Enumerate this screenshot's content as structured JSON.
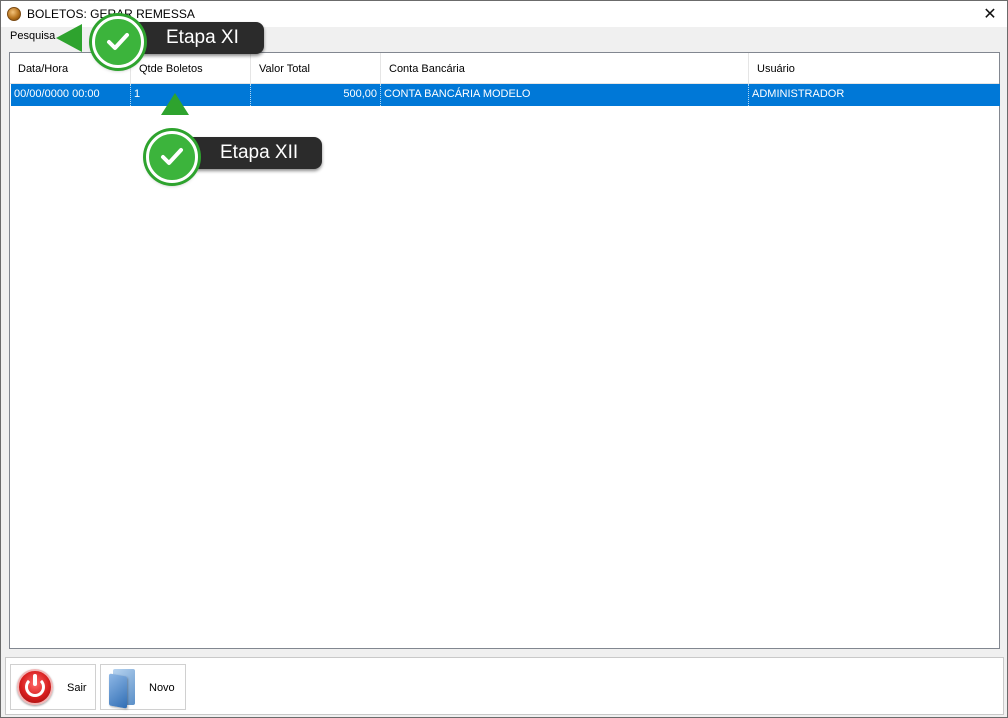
{
  "window": {
    "title": "BOLETOS: GERAR REMESSA",
    "close_glyph": "✕"
  },
  "menu": {
    "items": [
      {
        "label": "Pesquisa"
      }
    ]
  },
  "grid": {
    "columns": [
      "Data/Hora",
      "Qtde Boletos",
      "Valor Total",
      "Conta Bancária",
      "Usuário"
    ],
    "rows": [
      {
        "data_hora": "00/00/0000 00:00",
        "qtde_boletos": "1",
        "valor_total": "500,00",
        "conta_bancaria": "CONTA BANCÁRIA MODELO",
        "usuario": "ADMINISTRADOR",
        "selected": true
      }
    ]
  },
  "toolbar": {
    "sair_label": "Sair",
    "sair_icon": "power-icon",
    "novo_label": "Novo",
    "novo_icon": "folder-icon"
  },
  "callouts": {
    "step11": "Etapa XI",
    "step12": "Etapa XII"
  },
  "colors": {
    "selection": "#0078d7",
    "callout_green": "#3cb43c",
    "callout_dark": "#2b2b2b"
  }
}
